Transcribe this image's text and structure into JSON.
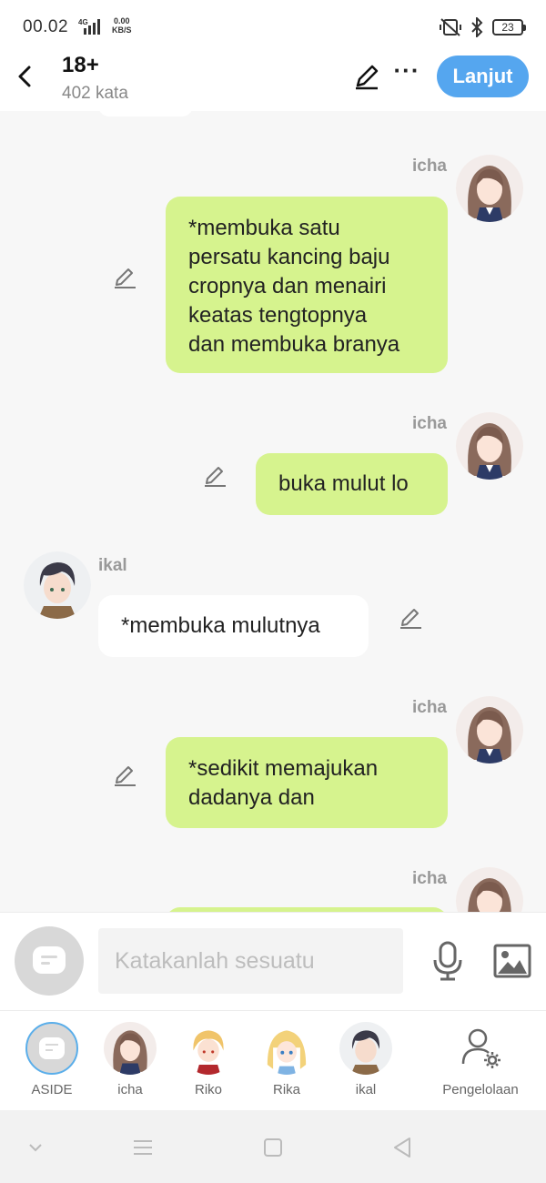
{
  "status_bar": {
    "time": "00.02",
    "network": "4G",
    "speed_value": "0.00",
    "speed_unit": "KB/S",
    "battery": "23",
    "icons": [
      "mute-icon",
      "bluetooth-icon",
      "battery-icon"
    ]
  },
  "header": {
    "title": "18+",
    "word_count": "402 kata",
    "next_label": "Lanjut",
    "icons": [
      "back-icon",
      "pencil-icon",
      "more-icon"
    ]
  },
  "messages": [
    {
      "sender": "icha",
      "side": "right",
      "text_lines": [
        "*membuka satu",
        "persatu kancing baju",
        "cropnya dan menairi",
        "keatas tengtopnya",
        "dan membuka branya"
      ]
    },
    {
      "sender": "icha",
      "side": "right",
      "text_lines": [
        "buka mulut lo"
      ]
    },
    {
      "sender": "ikal",
      "side": "left",
      "text_lines": [
        "*membuka mulutnya"
      ]
    },
    {
      "sender": "icha",
      "side": "right",
      "text_lines": [
        "*sedikit memajukan",
        "dadanya dan"
      ]
    },
    {
      "sender": "icha",
      "side": "right",
      "text_lines": []
    }
  ],
  "input": {
    "placeholder": "Katakanlah sesuatu",
    "icons": [
      "aside-icon",
      "microphone-icon",
      "image-icon"
    ]
  },
  "characters": [
    {
      "label": "ASIDE"
    },
    {
      "label": "icha"
    },
    {
      "label": "Riko"
    },
    {
      "label": "Rika"
    },
    {
      "label": "ikal"
    },
    {
      "label": "Pengelolaan"
    }
  ],
  "nav": {
    "icons": [
      "nav-down-icon",
      "nav-menu-icon",
      "nav-home-icon",
      "nav-back-icon"
    ]
  },
  "colors": {
    "accent": "#55a6ef",
    "bubble_self": "#d6f38e",
    "bubble_other": "#ffffff",
    "background": "#f7f7f7"
  }
}
